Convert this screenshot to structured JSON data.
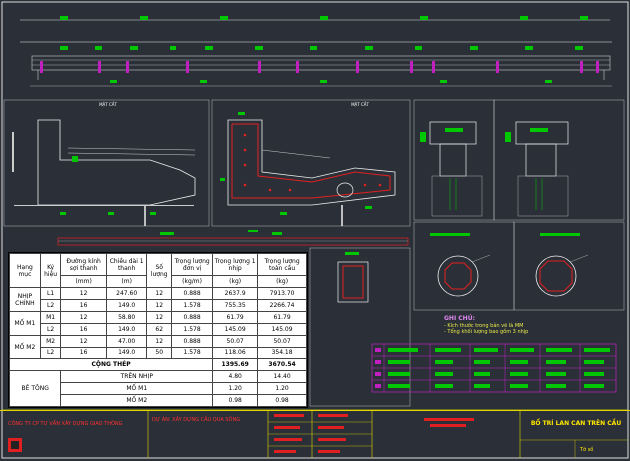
{
  "table": {
    "headers": [
      "Hạng mục",
      "Ký hiệu",
      "Đường kính sợi thanh",
      "Chiều dài 1 thanh",
      "Số lượng",
      "Trọng lượng đơn vị",
      "Trọng lượng 1 nhịp",
      "Trọng lượng toàn cầu"
    ],
    "units": [
      "",
      "",
      "(mm)",
      "(m)",
      "",
      "(kg/m)",
      "(kg)",
      "(kg)"
    ],
    "rows": [
      {
        "group": "NHỊP CHÍNH",
        "code": "L1",
        "dia": "12",
        "len": "247.60",
        "qty": "12",
        "unit": "0.888",
        "w1": "2637.9",
        "wt": "7913.70"
      },
      {
        "group": "",
        "code": "L2",
        "dia": "16",
        "len": "149.0",
        "qty": "12",
        "unit": "1.578",
        "w1": "755.35",
        "wt": "2266.74"
      },
      {
        "group": "MỐ M1",
        "code": "M1",
        "dia": "12",
        "len": "58.80",
        "qty": "12",
        "unit": "0.888",
        "w1": "61.79",
        "wt": "61.79"
      },
      {
        "group": "",
        "code": "L2",
        "dia": "16",
        "len": "149.0",
        "qty": "62",
        "unit": "1.578",
        "w1": "145.09",
        "wt": "145.09"
      },
      {
        "group": "MỐ M2",
        "code": "M2",
        "dia": "12",
        "len": "47.00",
        "qty": "12",
        "unit": "0.888",
        "w1": "50.07",
        "wt": "50.07"
      },
      {
        "group": "",
        "code": "L2",
        "dia": "16",
        "len": "149.0",
        "qty": "50",
        "unit": "1.578",
        "w1": "118.06",
        "wt": "354.18"
      }
    ],
    "total_label": "CỘNG THÉP",
    "total_w1": "1395.69",
    "total_wt": "3670.54",
    "concrete_label": "BÊ TÔNG",
    "concrete_rows": [
      {
        "item": "TRÊN NHỊP",
        "w1": "4.80",
        "wt": "14.40"
      },
      {
        "item": "MỐ M1",
        "w1": "1.20",
        "wt": "1.20"
      },
      {
        "item": "MỐ M2",
        "w1": "0.98",
        "wt": "0.98"
      }
    ]
  },
  "notes": {
    "heading": "GHI CHÚ:",
    "items": [
      "- Kích thước trong bản vẽ là MM",
      "- Tổng khối lượng bao gồm 3 nhịp"
    ]
  },
  "title_block": {
    "company": "CÔNG TY CP TƯ VẤN XÂY DỰNG GIAO THÔNG",
    "project": "DỰ ÁN: XÂY DỰNG CẦU QUA SÔNG",
    "drawing_title": "BỐ TRÍ LAN CAN TRÊN CẦU",
    "sheet": "Tờ số"
  },
  "colors": {
    "background": "#2b3038",
    "dimension": "#00d000",
    "section": "#e02020",
    "rebar": "#c020c0",
    "frame": "#f0f0f0",
    "titleblock": "#e0d800"
  }
}
